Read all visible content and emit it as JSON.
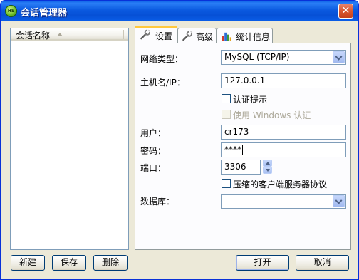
{
  "window": {
    "title": "会话管理器",
    "app_icon_text": "HS",
    "close_glyph": "✕"
  },
  "list": {
    "column_header": "会话名称"
  },
  "tabs": [
    {
      "label": "设置",
      "icon": "wrench-icon",
      "active": true
    },
    {
      "label": "高级",
      "icon": "wrench-icon",
      "active": false
    },
    {
      "label": "统计信息",
      "icon": "bar-chart-icon",
      "active": false
    }
  ],
  "form": {
    "network_type_label": "网络类型：",
    "network_type_value": "MySQL (TCP/IP)",
    "host_label": "主机名/IP：",
    "host_value": "127.0.0.1",
    "auth_prompt_label": "认证提示",
    "windows_auth_label": "使用 Windows 认证",
    "user_label": "用户：",
    "user_value": "cr173",
    "password_label": "密码：",
    "password_value": "****",
    "port_label": "端口：",
    "port_value": "3306",
    "compress_label": "压缩的客户端服务器协议",
    "database_label": "数据库：",
    "database_value": ""
  },
  "buttons": {
    "new": "新建",
    "save": "保存",
    "delete": "删除",
    "open": "打开",
    "cancel": "取消"
  }
}
